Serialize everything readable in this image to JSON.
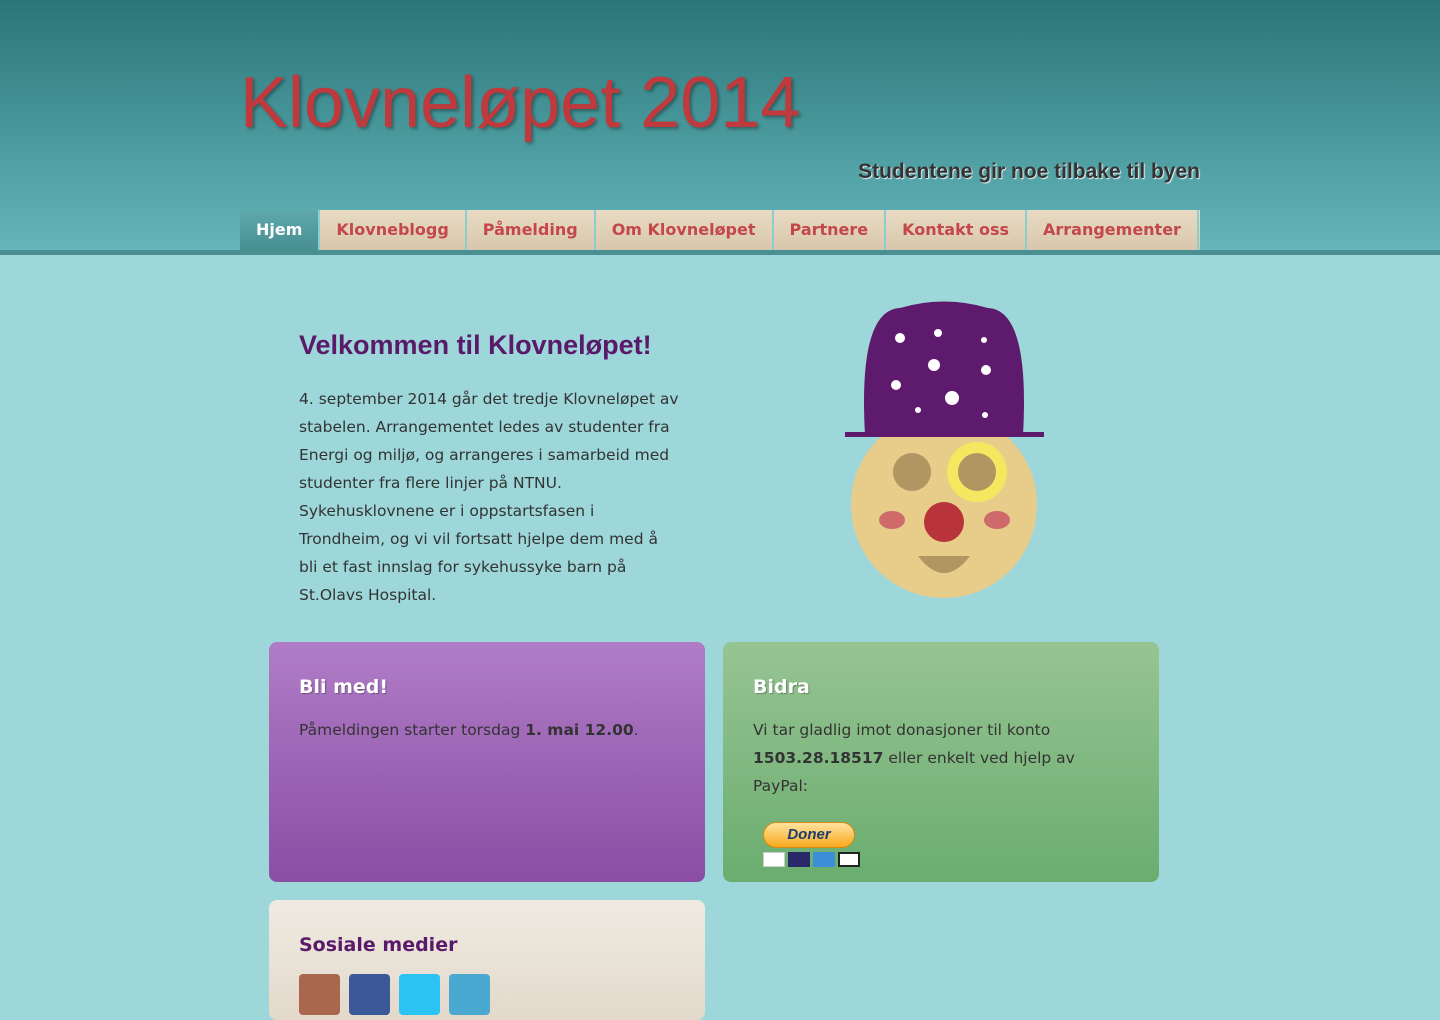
{
  "header": {
    "title": "Klovneløpet 2014",
    "tagline": "Studentene gir noe tilbake til byen"
  },
  "nav": {
    "items": [
      {
        "label": "Hjem",
        "active": true
      },
      {
        "label": "Klovneblogg"
      },
      {
        "label": "Påmelding"
      },
      {
        "label": "Om Klovneløpet"
      },
      {
        "label": "Partnere"
      },
      {
        "label": "Kontakt oss"
      },
      {
        "label": "Arrangementer"
      }
    ]
  },
  "welcome": {
    "title": "Velkommen til Klovneløpet!",
    "text": "4. september 2014 går det tredje Klovneløpet av stabelen. Arrangementet ledes av studenter fra Energi og miljø, og arrangeres i samarbeid med studenter fra flere linjer på NTNU. Sykehusklovnene er i oppstartsfasen i Trondheim, og vi vil fortsatt hjelpe dem med å bli et fast innslag for sykehussyke barn på St.Olavs Hospital."
  },
  "join": {
    "title": "Bli med!",
    "text_before": "Påmeldingen starter torsdag ",
    "text_bold": "1. mai 12.00",
    "text_after": "."
  },
  "donate": {
    "title": "Bidra",
    "text_before": "Vi tar gladlig imot donasjoner til konto ",
    "account": "1503.28.18517",
    "text_after": " eller enkelt ved hjelp av PayPal:",
    "button": "Doner"
  },
  "social": {
    "title": "Sosiale medier",
    "icons": [
      "instagram-icon",
      "facebook-icon",
      "twitter-icon",
      "vimeo-icon"
    ]
  }
}
